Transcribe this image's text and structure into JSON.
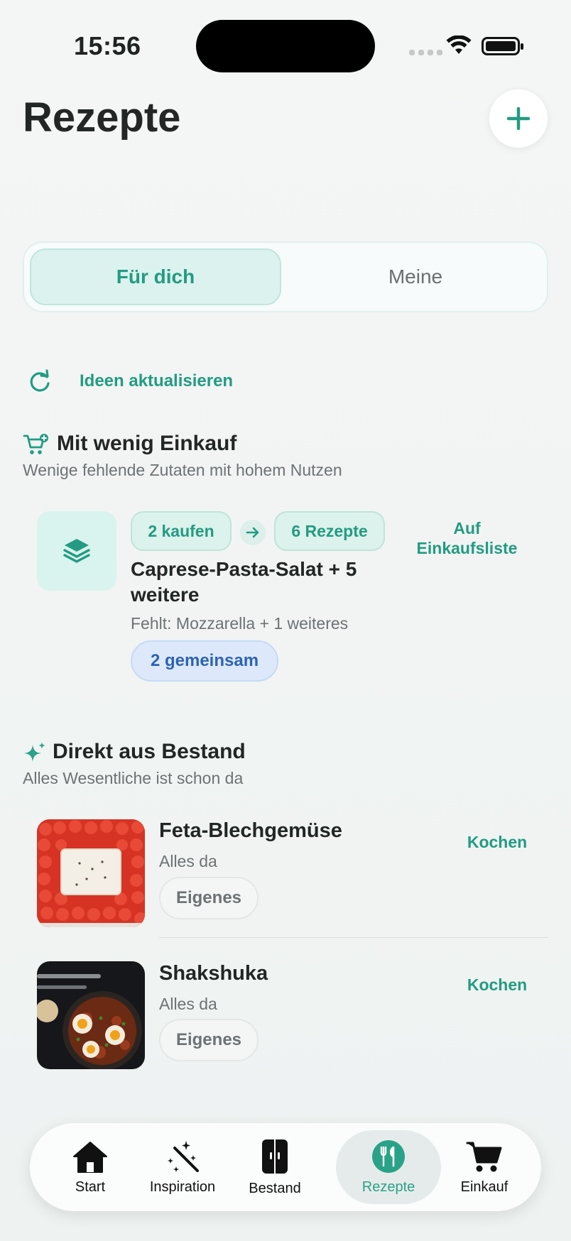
{
  "status_bar": {
    "time": "15:56"
  },
  "header": {
    "title": "Rezepte"
  },
  "segments": {
    "active": "Für dich",
    "inactive": "Meine"
  },
  "refresh": {
    "label": "Ideen aktualisieren"
  },
  "section_low_shop": {
    "title": "Mit wenig Einkauf",
    "subtitle": "Wenige fehlende Zutaten mit hohem Nutzen",
    "card": {
      "buy_chip": "2 kaufen",
      "recipes_chip": "6 Rezepte",
      "title": "Caprese-Pasta-Salat + 5 weitere",
      "missing": "Fehlt: Mozzarella + 1 weiteres",
      "common_badge": "2 gemeinsam",
      "action": "Auf Einkaufsliste"
    }
  },
  "section_stock": {
    "title": "Direkt aus Bestand",
    "subtitle": "Alles Wesentliche ist schon da",
    "recipes": [
      {
        "name": "Feta-Blechgemüse",
        "status": "Alles da",
        "badge": "Eigenes",
        "action": "Kochen"
      },
      {
        "name": "Shakshuka",
        "status": "Alles da",
        "badge": "Eigenes",
        "action": "Kochen"
      }
    ]
  },
  "tab_bar": {
    "active": "Rezepte",
    "tabs": [
      {
        "label": "Start"
      },
      {
        "label": "Inspiration"
      },
      {
        "label": "Bestand"
      },
      {
        "label": "Rezepte"
      },
      {
        "label": "Einkauf"
      }
    ]
  },
  "colors": {
    "accent": "#239b82",
    "blue_badge": "#2e63b3"
  }
}
